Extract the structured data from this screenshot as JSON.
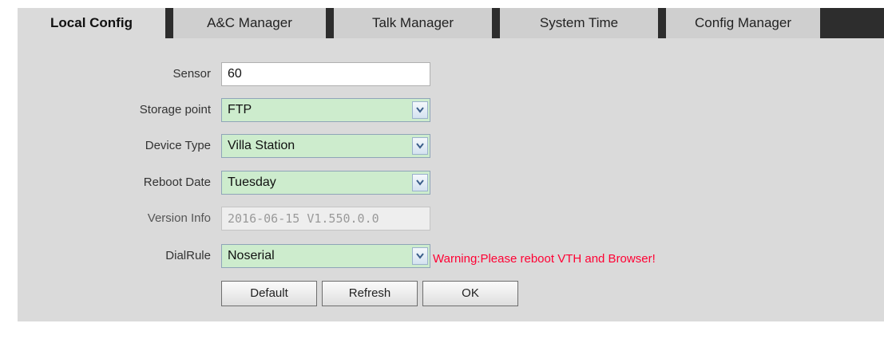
{
  "tabs": [
    {
      "label": "Local Config",
      "active": true
    },
    {
      "label": "A&C Manager",
      "active": false
    },
    {
      "label": "Talk Manager",
      "active": false
    },
    {
      "label": "System Time",
      "active": false
    },
    {
      "label": "Config Manager",
      "active": false
    }
  ],
  "form": {
    "sensor": {
      "label": "Sensor",
      "value": "60"
    },
    "storage_point": {
      "label": "Storage point",
      "value": "FTP"
    },
    "device_type": {
      "label": "Device Type",
      "value": "Villa Station"
    },
    "reboot_date": {
      "label": "Reboot Date",
      "value": "Tuesday"
    },
    "version_info": {
      "label": "Version Info",
      "value": "2016-06-15 V1.550.0.0"
    },
    "dial_rule": {
      "label": "DialRule",
      "value": "Noserial"
    },
    "warning": "Warning:Please reboot VTH and Browser!"
  },
  "buttons": {
    "default": "Default",
    "refresh": "Refresh",
    "ok": "OK"
  },
  "colors": {
    "tab_bar": "#2d2d2d",
    "panel": "#dadada",
    "select_bg": "#cdeccd",
    "warning": "#ff0033"
  },
  "icons": {
    "select_arrow": "chevron-down-icon"
  }
}
